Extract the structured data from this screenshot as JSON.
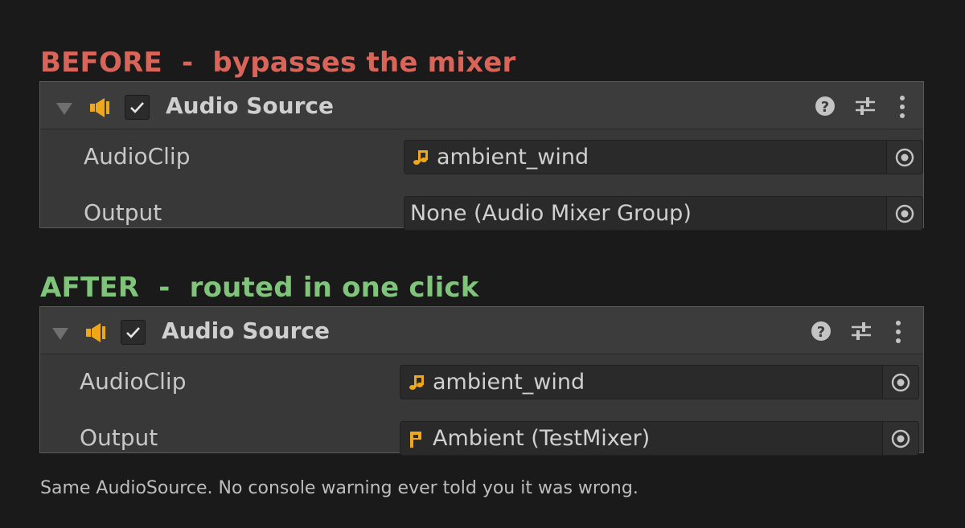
{
  "before": {
    "caption": "BEFORE  -  bypasses the mixer",
    "caption_color": "#d9655a",
    "component": {
      "title": "Audio Source",
      "speaker_icon": "speaker-icon",
      "enabled": true
    },
    "audio_clip": {
      "label": "AudioClip",
      "value": "ambient_wind",
      "icon": "music-note-icon"
    },
    "output": {
      "label": "Output",
      "value": "None (Audio Mixer Group)"
    }
  },
  "after": {
    "caption": "AFTER  -  routed in one click",
    "caption_color": "#7fc47a",
    "component": {
      "title": "Audio Source",
      "speaker_icon": "speaker-icon",
      "enabled": true
    },
    "audio_clip": {
      "label": "AudioClip",
      "value": "ambient_wind",
      "icon": "music-note-icon"
    },
    "output": {
      "label": "Output",
      "value": "Ambient (TestMixer)",
      "icon": "mixer-group-icon"
    }
  },
  "accent_icon_color": "#f0a818",
  "footnote": "Same AudioSource. No console warning ever told you it was wrong."
}
